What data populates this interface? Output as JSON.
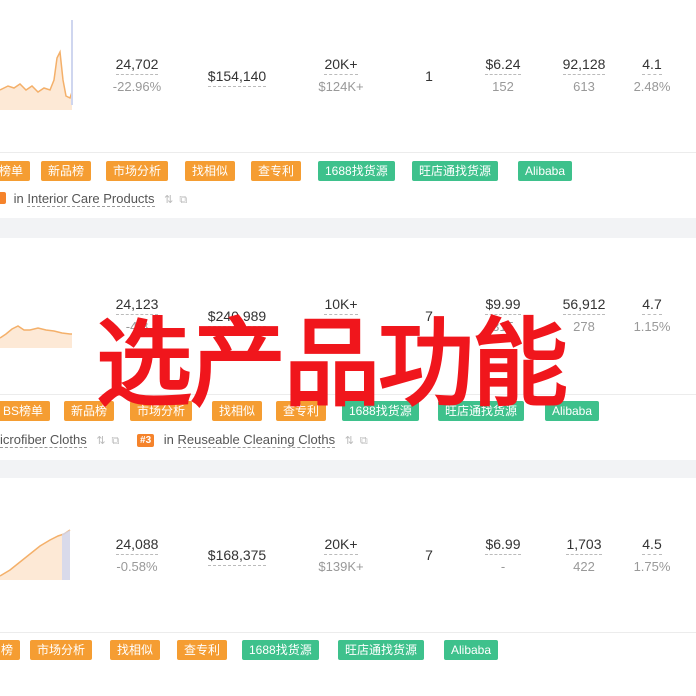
{
  "products": [
    {
      "sales": "24,702",
      "sales_change": "-22.96%",
      "revenue": "$154,140",
      "sales_est": "20K+",
      "revenue_est": "$124K+",
      "variations": "1",
      "price": "$6.24",
      "price_sub": "152",
      "ratings": "92,128",
      "ratings_sub": "613",
      "rating": "4.1",
      "rating_sub": "2.48%",
      "tags": [
        "榜单",
        "新品榜",
        "市场分析",
        "找相似",
        "查专利",
        "1688找货源",
        "旺店通找货源",
        "Alibaba"
      ],
      "rank_prefix": "in",
      "rank_category": "Interior Care Products"
    },
    {
      "sales": "24,123",
      "sales_change": "-4.8",
      "revenue": "$240,989",
      "sales_est": "10K+",
      "revenue_est": "",
      "variations": "7",
      "price": "$9.99",
      "price_sub": "315",
      "ratings": "56,912",
      "ratings_sub": "278",
      "rating": "4.7",
      "rating_sub": "1.15%",
      "tags": [
        "BS榜单",
        "新品榜",
        "市场分析",
        "找相似",
        "查专利",
        "1688找货源",
        "旺店通找货源",
        "Alibaba"
      ],
      "rank_category_1": "icrofiber Cloths",
      "rank_badge": "#3",
      "rank_prefix": "in",
      "rank_category_2": "Reuseable Cleaning Cloths"
    },
    {
      "sales": "24,088",
      "sales_change": "-0.58%",
      "revenue": "$168,375",
      "sales_est": "20K+",
      "revenue_est": "$139K+",
      "variations": "7",
      "price": "$6.99",
      "price_sub": "-",
      "ratings": "1,703",
      "ratings_sub": "422",
      "rating": "4.5",
      "rating_sub": "1.75%",
      "tags": [
        "榜",
        "市场分析",
        "找相似",
        "查专利",
        "1688找货源",
        "旺店通找货源",
        "Alibaba"
      ]
    }
  ],
  "overlay_text": "选产品功能",
  "colors": {
    "tag_orange": "#f59d32",
    "tag_green": "#3ec18c",
    "overlay_red": "#f0161c",
    "sparkline": "#f4b06a"
  }
}
